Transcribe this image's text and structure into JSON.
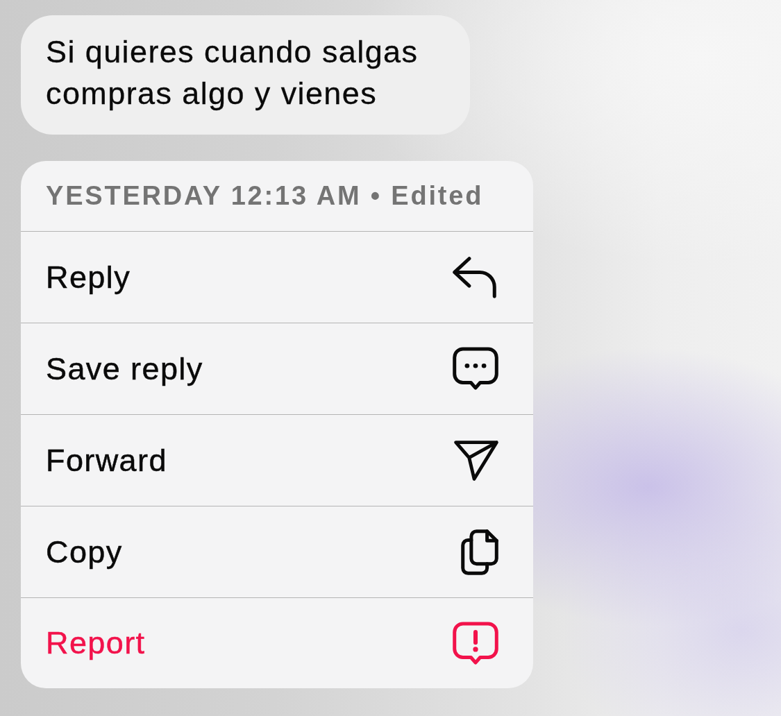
{
  "message": {
    "text": "Si quieres cuando salgas compras algo y vienes"
  },
  "menu": {
    "header": "YESTERDAY 12:13 AM • Edited",
    "items": [
      {
        "label": "Reply",
        "kind": "reply",
        "destructive": false
      },
      {
        "label": "Save reply",
        "kind": "save",
        "destructive": false
      },
      {
        "label": "Forward",
        "kind": "forward",
        "destructive": false
      },
      {
        "label": "Copy",
        "kind": "copy",
        "destructive": false
      },
      {
        "label": "Report",
        "kind": "report",
        "destructive": true
      }
    ]
  }
}
